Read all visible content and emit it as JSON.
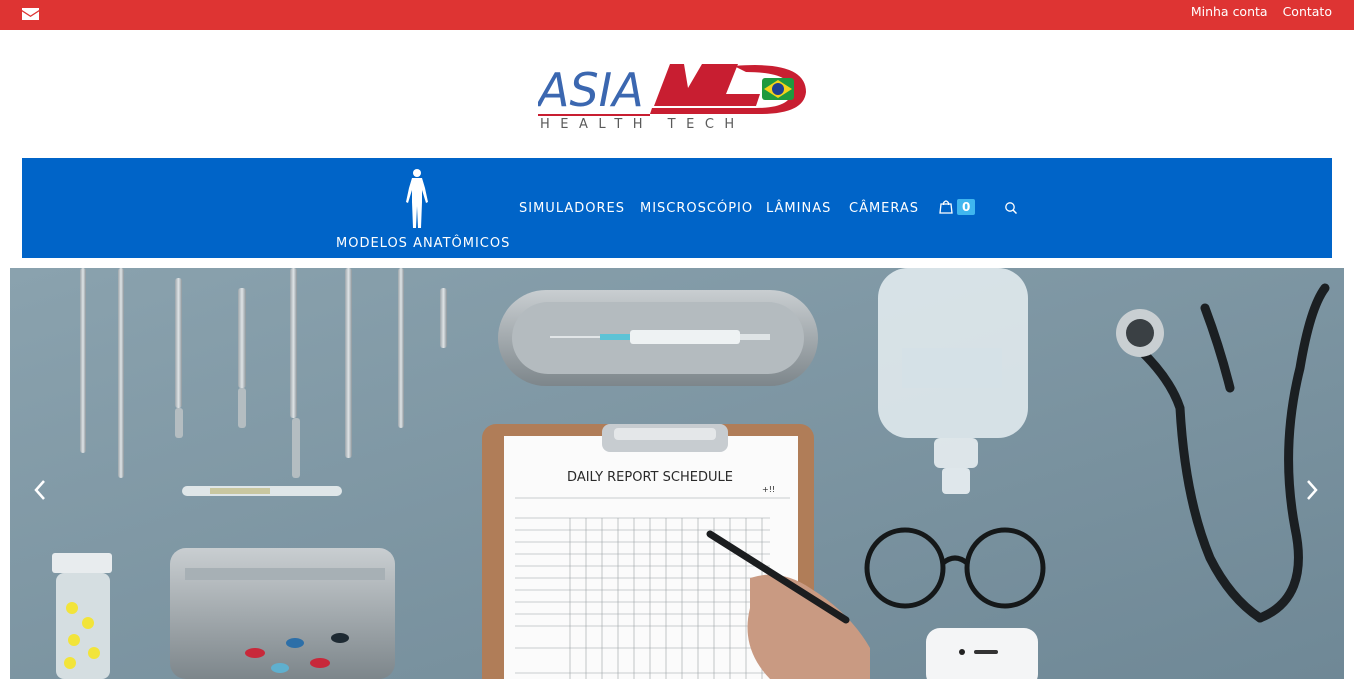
{
  "topbar": {
    "background": "#de3433",
    "icon": "envelope-icon",
    "links": {
      "account": "Minha conta",
      "contact": "Contato"
    }
  },
  "logo": {
    "brand_part1": "ASIA",
    "brand_part2": "MED",
    "tagline": "HEALTH TECH",
    "brand_blue": "#3b67b0",
    "brand_red": "#c81e31"
  },
  "nav": {
    "background": "#0064c8",
    "items": [
      {
        "label": "MODELOS ANATÔMICOS",
        "icon": "human-figure-icon"
      },
      {
        "label": "SIMULADORES"
      },
      {
        "label": "MISCROSCÓPIO"
      },
      {
        "label": "LÂMINAS"
      },
      {
        "label": "CÂMERAS"
      }
    ],
    "cart": {
      "icon": "shopping-bag-icon",
      "count": "0",
      "badge_color": "#3fb6ef"
    },
    "search_icon": "search-icon"
  },
  "hero": {
    "clipboard_title": "DAILY REPORT SCHEDULE",
    "clipboard_mark": "+!!",
    "prev_icon": "chevron-left-icon",
    "next_icon": "chevron-right-icon",
    "background": "#7e97a4"
  }
}
